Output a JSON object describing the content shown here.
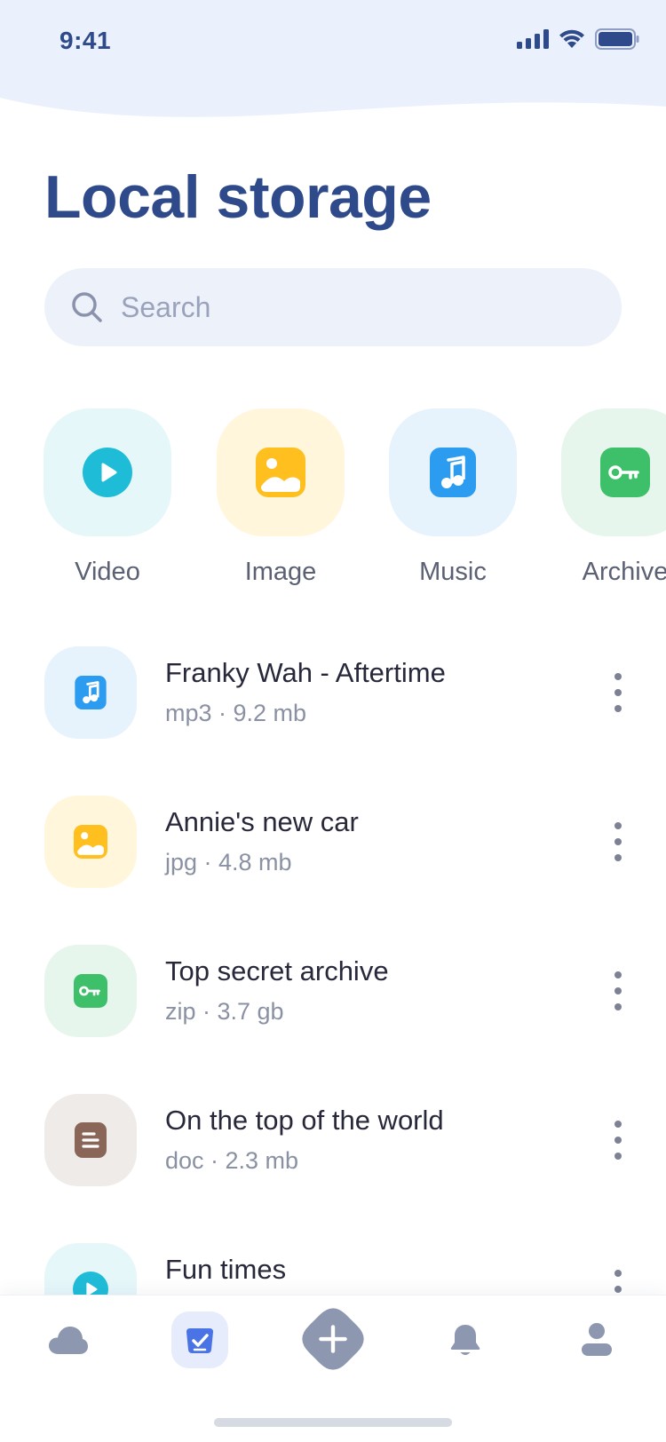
{
  "status_bar": {
    "time": "9:41"
  },
  "page": {
    "title": "Local storage"
  },
  "search": {
    "placeholder": "Search"
  },
  "categories": [
    {
      "label": "Video",
      "icon": "play-icon",
      "color": "#1fbcd8",
      "bg": "#e6f7fa"
    },
    {
      "label": "Image",
      "icon": "image-icon",
      "color": "#ffbf1f",
      "bg": "#fff6dc"
    },
    {
      "label": "Music",
      "icon": "music-icon",
      "color": "#2b9cf0",
      "bg": "#e6f3fd"
    },
    {
      "label": "Archive",
      "icon": "key-icon",
      "color": "#3ec06a",
      "bg": "#e7f6ec"
    }
  ],
  "files": [
    {
      "name": "Franky Wah - Aftertime",
      "meta": "mp3 · 9.2 mb",
      "icon": "music-icon"
    },
    {
      "name": "Annie's new car",
      "meta": "jpg · 4.8 mb",
      "icon": "image-icon"
    },
    {
      "name": "Top secret archive",
      "meta": "zip · 3.7 gb",
      "icon": "key-icon"
    },
    {
      "name": "On the top of the world",
      "meta": "doc · 2.3 mb",
      "icon": "document-icon"
    },
    {
      "name": "Fun times",
      "meta": "",
      "icon": "play-icon"
    }
  ],
  "bottom_nav": [
    {
      "name": "cloud-icon"
    },
    {
      "name": "checklist-icon",
      "active": true
    },
    {
      "name": "add-icon"
    },
    {
      "name": "bell-icon"
    },
    {
      "name": "profile-icon"
    }
  ],
  "colors": {
    "brand": "#2f4a8a",
    "header_bg": "#eaf0fc",
    "nav_icon": "#8d97b0"
  }
}
